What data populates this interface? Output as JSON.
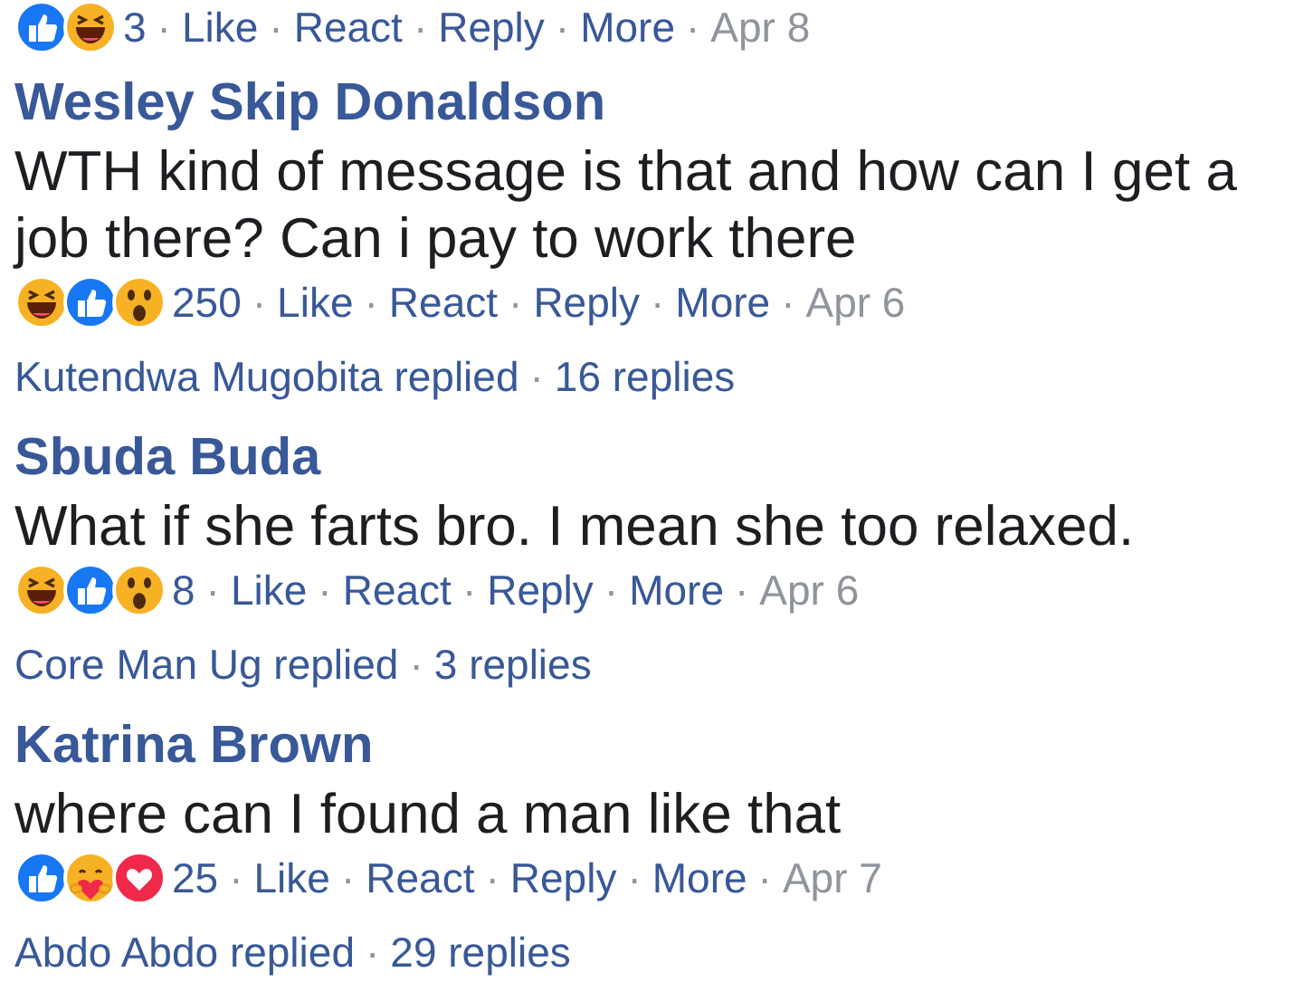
{
  "separator": "·",
  "comments": [
    {
      "reactions": [
        {
          "kind": "like"
        },
        {
          "kind": "haha"
        }
      ],
      "count": "3",
      "actions": [
        "Like",
        "React",
        "Reply",
        "More"
      ],
      "date": "Apr 8"
    },
    {
      "author": "Wesley Skip Donaldson",
      "text": "WTH kind of message is that and how can I get a job there? Can i pay to work there",
      "reactions": [
        {
          "kind": "haha"
        },
        {
          "kind": "like"
        },
        {
          "kind": "wow"
        }
      ],
      "count": "250",
      "actions": [
        "Like",
        "React",
        "Reply",
        "More"
      ],
      "date": "Apr 6",
      "replies": {
        "who": "Kutendwa Mugobita replied",
        "count": "16 replies"
      }
    },
    {
      "author": "Sbuda Buda",
      "text": "What if she farts bro. I mean she too relaxed.",
      "reactions": [
        {
          "kind": "haha"
        },
        {
          "kind": "like"
        },
        {
          "kind": "wow"
        }
      ],
      "count": "8",
      "actions": [
        "Like",
        "React",
        "Reply",
        "More"
      ],
      "date": "Apr 6",
      "replies": {
        "who": "Core Man Ug replied",
        "count": "3 replies"
      }
    },
    {
      "author": "Katrina Brown",
      "text": "where can I found a man like that",
      "reactions": [
        {
          "kind": "like"
        },
        {
          "kind": "care"
        },
        {
          "kind": "love"
        }
      ],
      "count": "25",
      "actions": [
        "Like",
        "React",
        "Reply",
        "More"
      ],
      "date": "Apr 7",
      "replies": {
        "who": "Abdo Abdo replied",
        "count": "29 replies"
      }
    }
  ]
}
